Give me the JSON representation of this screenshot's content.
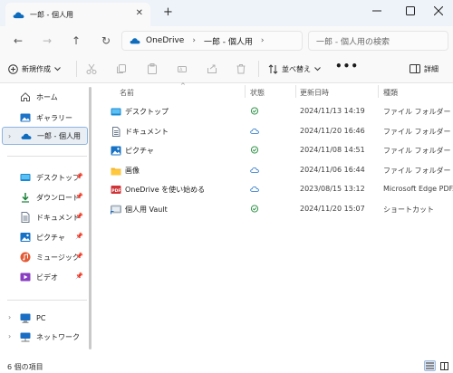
{
  "window": {
    "tab_title": "一郎 - 個人用",
    "tab_icon": "onedrive-cloud-icon",
    "accent_color": "#0f6cbd"
  },
  "address": {
    "crumbs": [
      "OneDrive",
      "一郎 - 個人用"
    ],
    "search_placeholder": "一郎 - 個人用の検索"
  },
  "toolbar": {
    "new_label": "新規作成",
    "sort_label": "並べ替え",
    "more_label": "•••",
    "details_label": "詳細"
  },
  "sidebar": {
    "quick": [
      {
        "label": "ホーム",
        "icon": "home-icon"
      },
      {
        "label": "ギャラリー",
        "icon": "gallery-icon"
      },
      {
        "label": "一郎 - 個人用",
        "icon": "onedrive-cloud-icon",
        "selected": true
      }
    ],
    "pinned": [
      {
        "label": "デスクトップ",
        "icon": "desktop-icon"
      },
      {
        "label": "ダウンロード",
        "icon": "download-icon"
      },
      {
        "label": "ドキュメント",
        "icon": "document-icon"
      },
      {
        "label": "ピクチャ",
        "icon": "pictures-icon"
      },
      {
        "label": "ミュージック",
        "icon": "music-icon"
      },
      {
        "label": "ビデオ",
        "icon": "video-icon"
      }
    ],
    "pc_label": "PC",
    "network_label": "ネットワーク"
  },
  "columns": {
    "name": "名前",
    "status": "状態",
    "modified": "更新日時",
    "type": "種類"
  },
  "files": [
    {
      "name": "デスクトップ",
      "icon": "desktop-icon",
      "status": "synced-check-icon",
      "modified": "2024/11/13 14:19",
      "type": "ファイル フォルダー"
    },
    {
      "name": "ドキュメント",
      "icon": "document-icon",
      "status": "cloud-only-icon",
      "modified": "2024/11/20 16:46",
      "type": "ファイル フォルダー"
    },
    {
      "name": "ピクチャ",
      "icon": "pictures-icon",
      "status": "synced-check-icon",
      "modified": "2024/11/08 14:51",
      "type": "ファイル フォルダー"
    },
    {
      "name": "画像",
      "icon": "folder-icon",
      "status": "cloud-only-icon",
      "modified": "2024/11/06 16:44",
      "type": "ファイル フォルダー"
    },
    {
      "name": "OneDrive を使い始める",
      "icon": "pdf-icon",
      "status": "cloud-only-icon",
      "modified": "2023/08/15 13:12",
      "type": "Microsoft Edge PDF..."
    },
    {
      "name": "個人用 Vault",
      "icon": "vault-shortcut-icon",
      "status": "synced-check-icon",
      "modified": "2024/11/20 15:07",
      "type": "ショートカット"
    }
  ],
  "statusbar": {
    "item_count": "6 個の項目"
  }
}
